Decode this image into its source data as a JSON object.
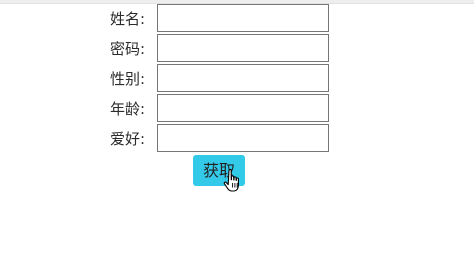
{
  "form": {
    "fields": [
      {
        "label": "姓名:",
        "value": ""
      },
      {
        "label": "密码:",
        "value": ""
      },
      {
        "label": "性别:",
        "value": ""
      },
      {
        "label": "年龄:",
        "value": ""
      },
      {
        "label": "爱好:",
        "value": ""
      }
    ],
    "submit_label": "获取"
  },
  "colors": {
    "button_bg": "#33c9e9"
  },
  "icons": {
    "cursor": "hand-pointer-icon"
  }
}
